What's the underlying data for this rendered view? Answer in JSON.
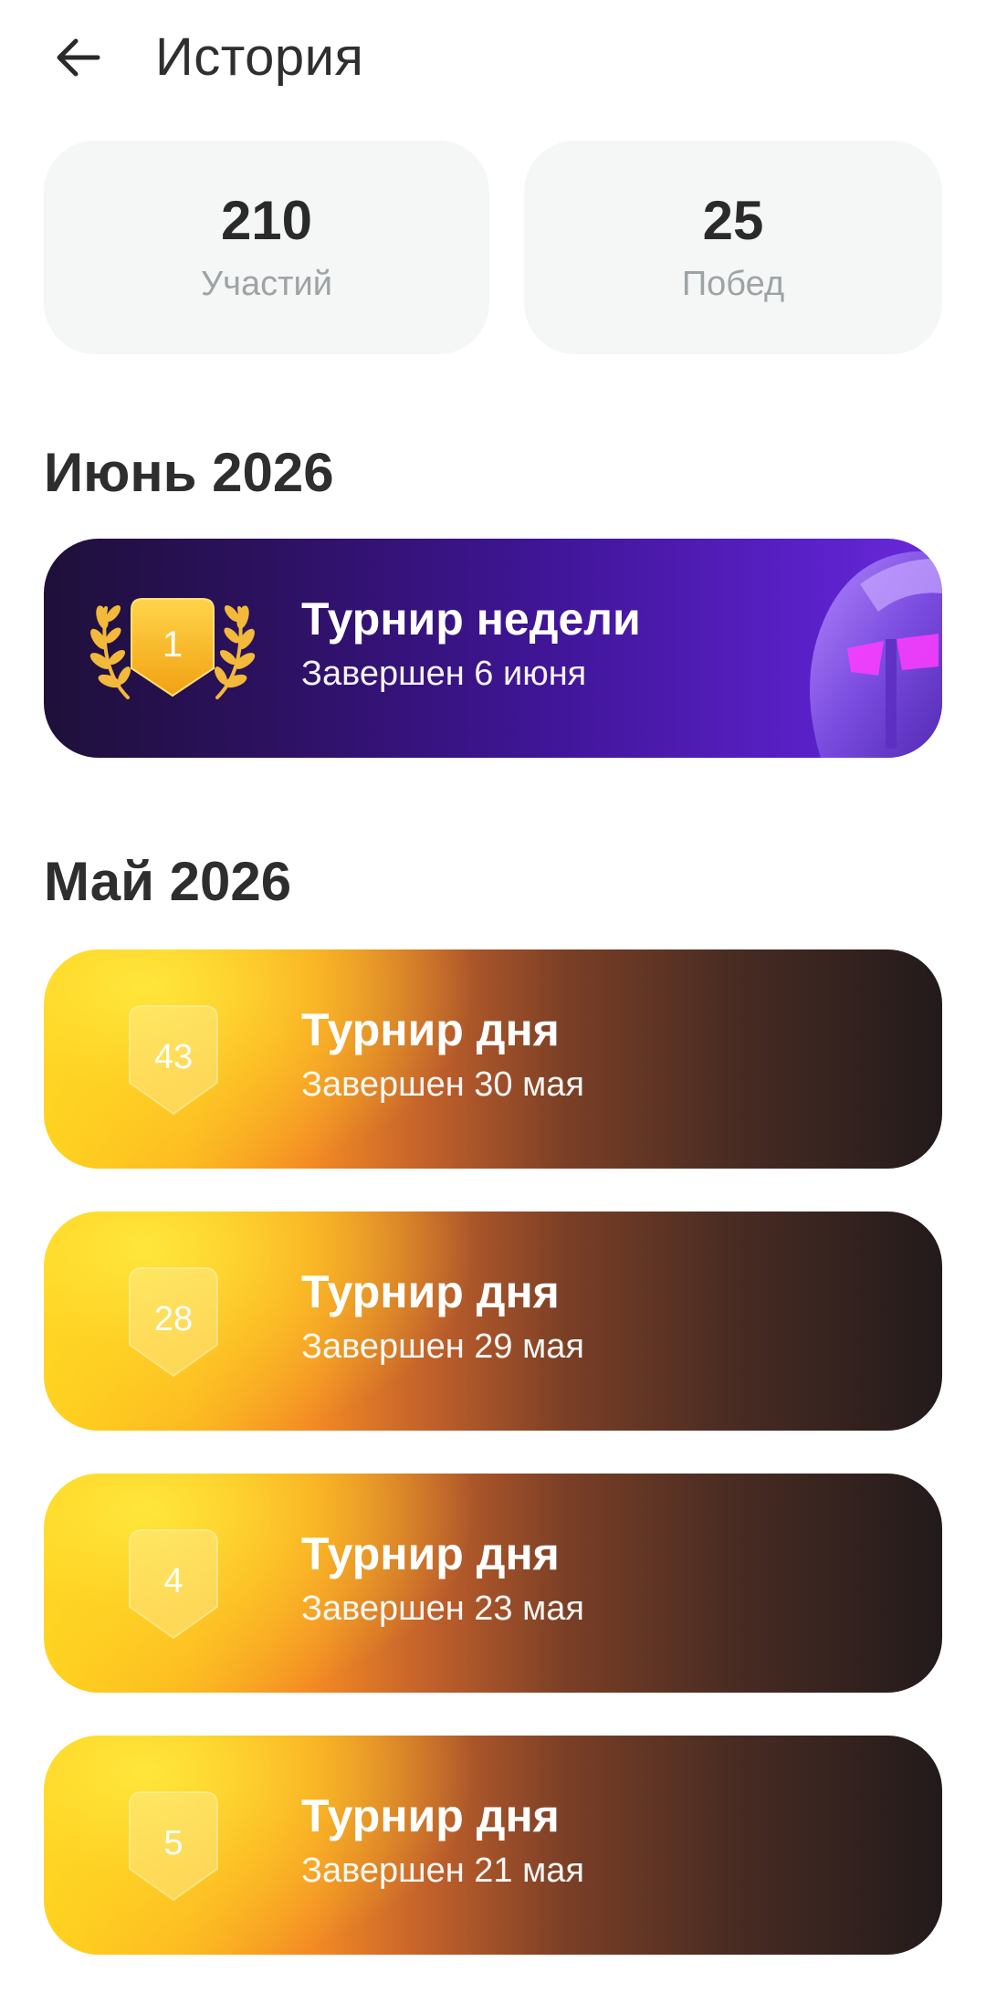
{
  "header": {
    "title": "История"
  },
  "stats": [
    {
      "value": "210",
      "label": "Участий"
    },
    {
      "value": "25",
      "label": "Побед"
    }
  ],
  "sections": [
    {
      "title": "Июнь 2026",
      "items": [
        {
          "rank": "1",
          "title": "Турнир недели",
          "subtitle": "Завершен 6 июня",
          "style": "week"
        }
      ]
    },
    {
      "title": "Май 2026",
      "items": [
        {
          "rank": "43",
          "title": "Турнир дня",
          "subtitle": "Завершен 30 мая",
          "style": "day"
        },
        {
          "rank": "28",
          "title": "Турнир дня",
          "subtitle": "Завершен 29 мая",
          "style": "day"
        },
        {
          "rank": "4",
          "title": "Турнир дня",
          "subtitle": "Завершен 23 мая",
          "style": "day"
        },
        {
          "rank": "5",
          "title": "Турнир дня",
          "subtitle": "Завершен 21 мая",
          "style": "day"
        }
      ]
    }
  ],
  "colors": {
    "week_card": "#3f1595",
    "day_card_start": "#ffd21e",
    "day_card_end": "#221a1b",
    "stat_card_bg": "#f5f6f6",
    "gold": "#f7b51c"
  },
  "icons": {
    "back": "arrow-left-icon",
    "laurel": "laurel-wreath-icon",
    "helmet": "spartan-helmet-icon",
    "badge": "shield-badge-icon"
  }
}
